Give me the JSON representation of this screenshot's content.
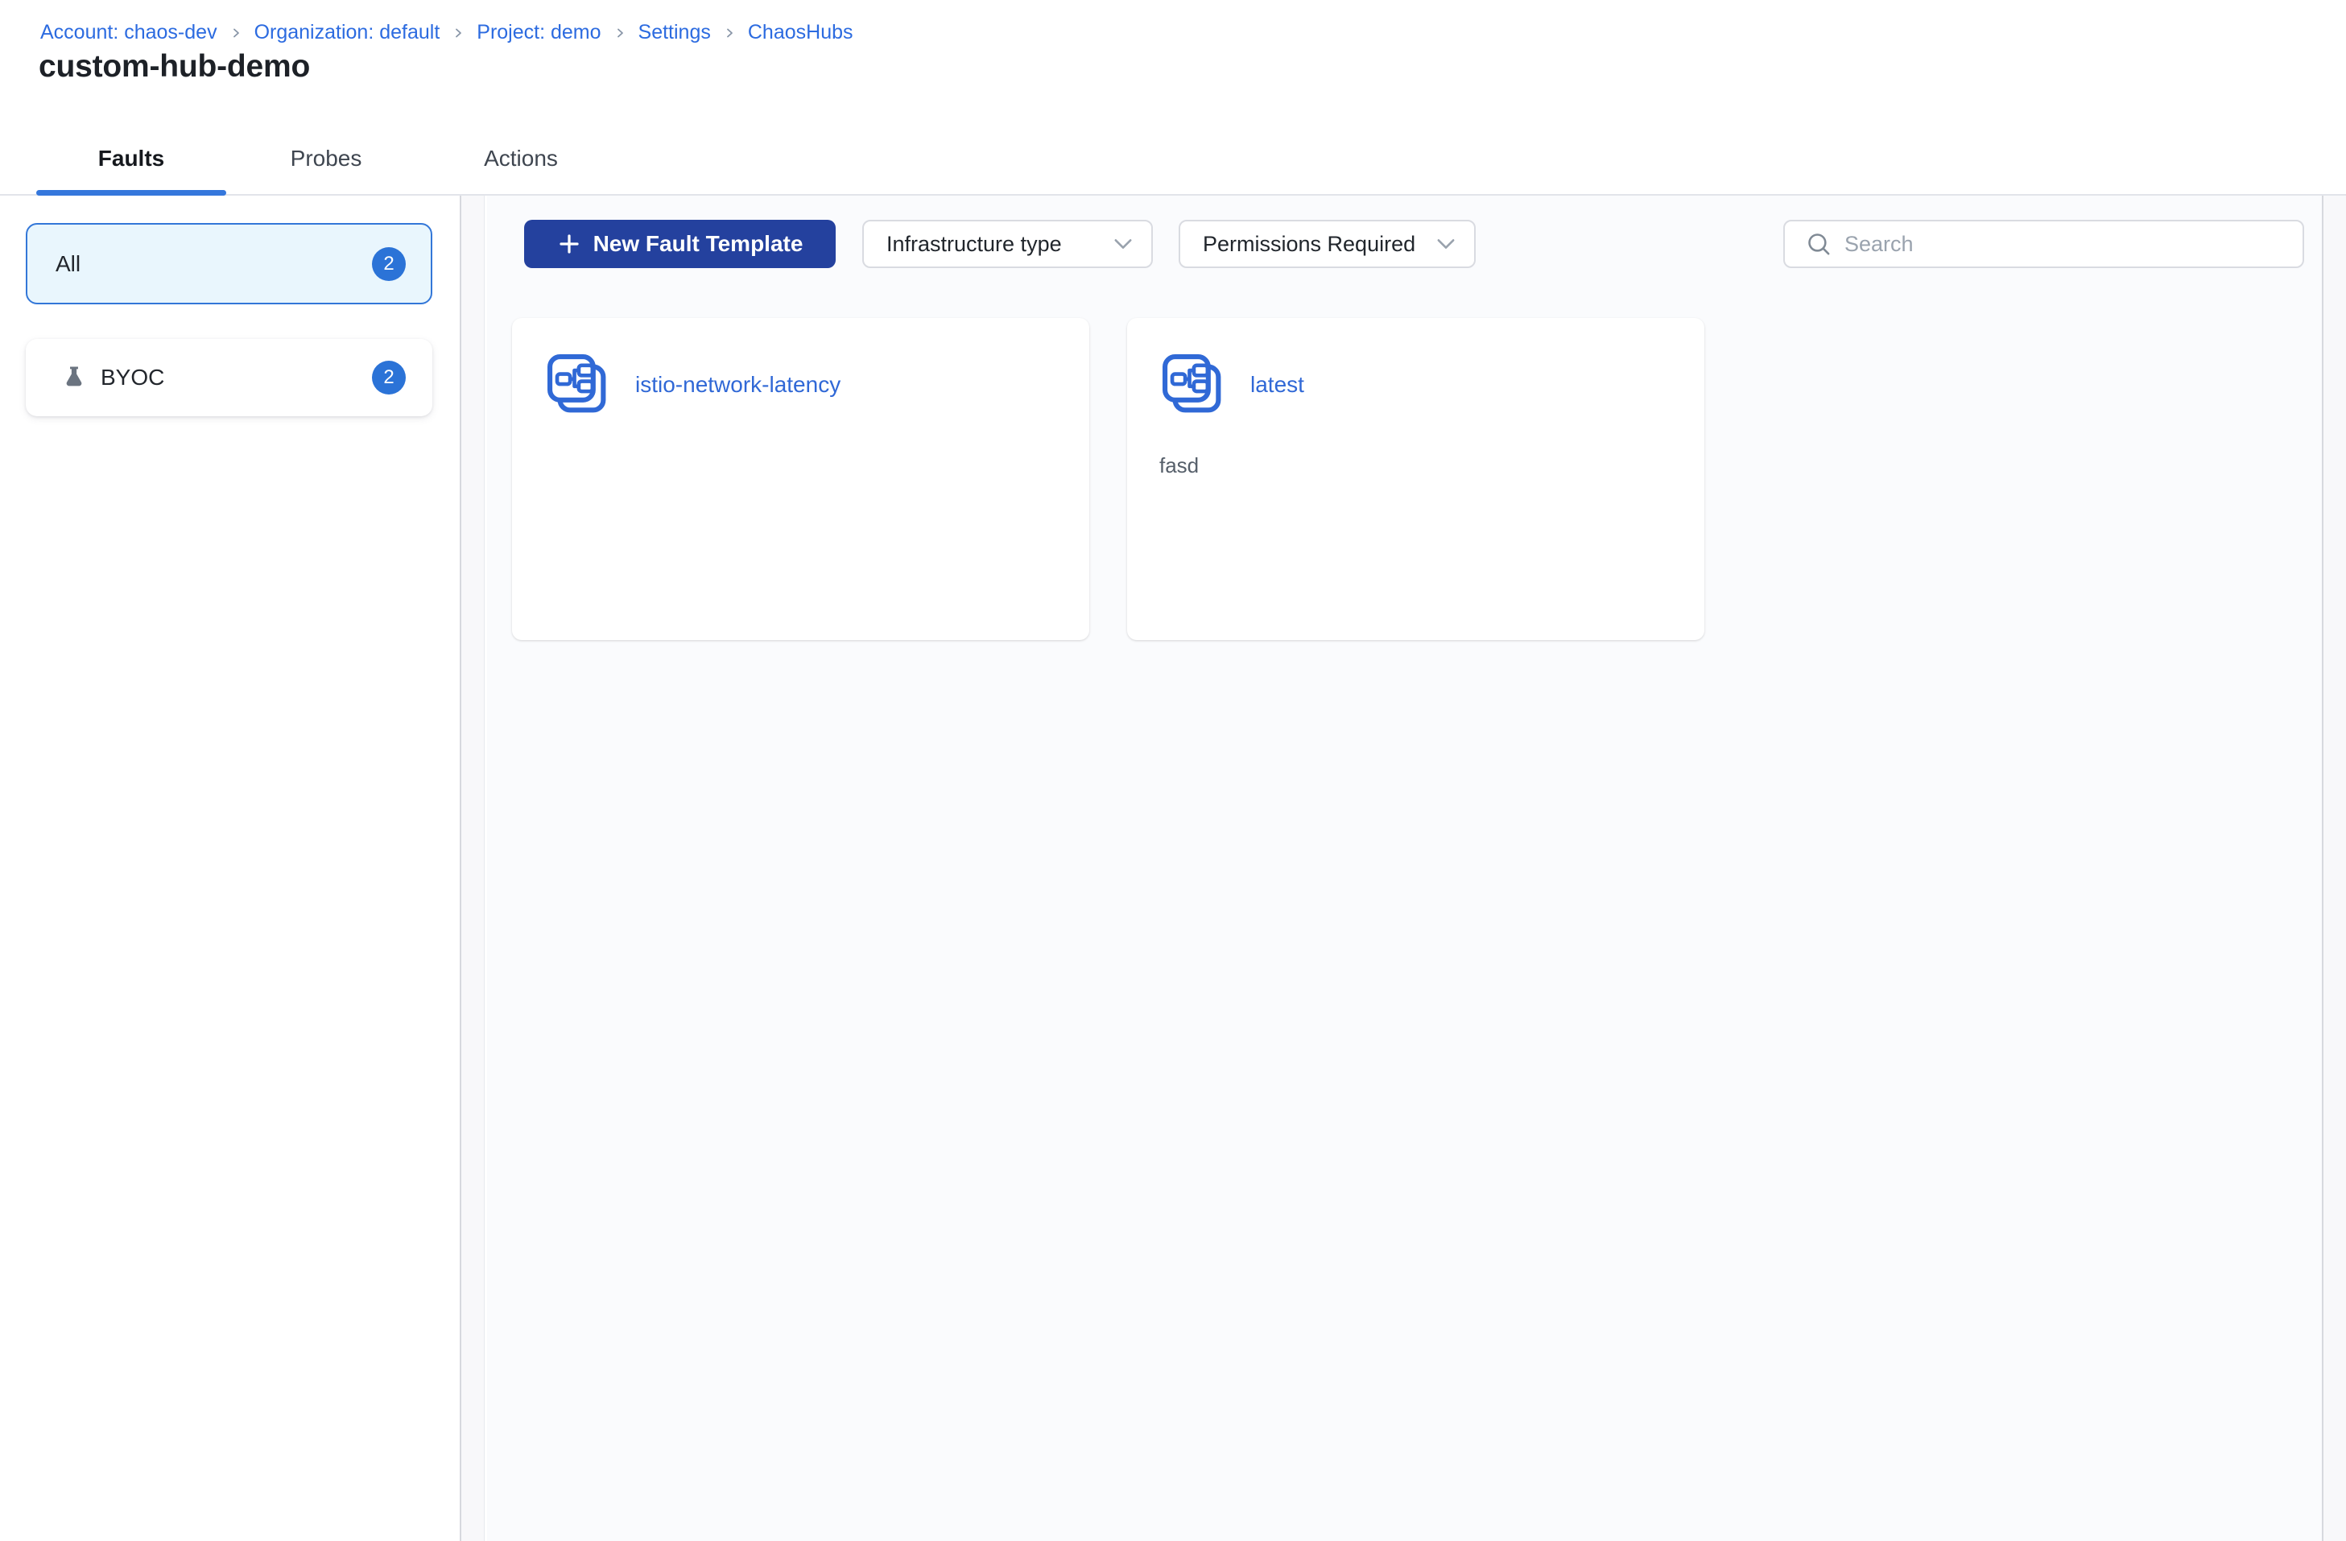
{
  "breadcrumb": {
    "items": [
      {
        "label": "Account: chaos-dev"
      },
      {
        "label": "Organization: default"
      },
      {
        "label": "Project: demo"
      },
      {
        "label": "Settings"
      },
      {
        "label": "ChaosHubs"
      }
    ]
  },
  "page": {
    "title": "custom-hub-demo"
  },
  "tabs": [
    {
      "label": "Faults",
      "active": true
    },
    {
      "label": "Probes",
      "active": false
    },
    {
      "label": "Actions",
      "active": false
    }
  ],
  "sidebar": {
    "categories": [
      {
        "label": "All",
        "count": "2",
        "selected": true
      },
      {
        "label": "BYOC",
        "count": "2",
        "icon": "flask-icon"
      }
    ]
  },
  "toolbar": {
    "new_template_button": "New Fault Template",
    "infrastructure_filter": "Infrastructure type",
    "permissions_filter": "Permissions Required",
    "search_placeholder": "Search"
  },
  "cards": [
    {
      "title": "istio-network-latency",
      "description": ""
    },
    {
      "title": "latest",
      "description": "fasd"
    }
  ],
  "colors": {
    "link_blue": "#2c6be0",
    "primary_button_blue": "#24419e",
    "badge_blue": "#2b73d7",
    "template_icon_blue": "#3069d6",
    "tab_underline_blue": "#3577dc",
    "selected_filter_bg": "#e9f6fd",
    "selected_filter_border": "#3377d8",
    "content_bg": "#fafbfd"
  }
}
